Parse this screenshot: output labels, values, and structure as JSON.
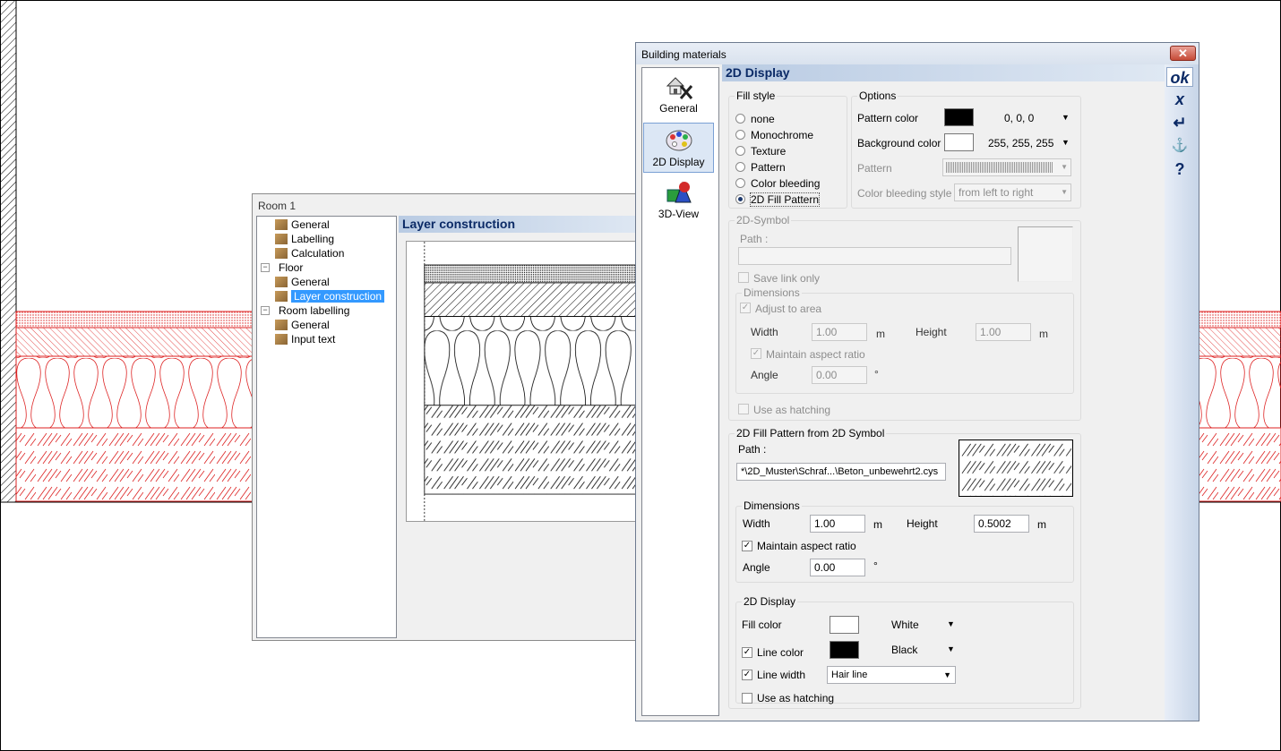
{
  "room_window": {
    "title": "Room 1",
    "section_header": "Layer construction",
    "tree": [
      {
        "label": "General",
        "indent": 1
      },
      {
        "label": "Labelling",
        "indent": 1
      },
      {
        "label": "Calculation",
        "indent": 1
      },
      {
        "label": "Floor",
        "indent": 0,
        "expand": "−"
      },
      {
        "label": "General",
        "indent": 1
      },
      {
        "label": "Layer construction",
        "indent": 1,
        "selected": true
      },
      {
        "label": "Room labelling",
        "indent": 0,
        "expand": "−"
      },
      {
        "label": "General",
        "indent": 1
      },
      {
        "label": "Input text",
        "indent": 1
      }
    ]
  },
  "dialog": {
    "title": "Building materials",
    "close_glyph": "✕",
    "section_header": "2D Display",
    "side_nav": [
      {
        "label": "General",
        "icon": "house-tools-icon"
      },
      {
        "label": "2D Display",
        "icon": "palette-icon",
        "active": true
      },
      {
        "label": "3D-View",
        "icon": "shapes-3d-icon"
      }
    ],
    "right_buttons": {
      "ok": "ok",
      "cancel": "x",
      "apply": "↵",
      "stamp": "⚓",
      "help": "?"
    },
    "fill_style": {
      "title": "Fill style",
      "options": [
        "none",
        "Monochrome",
        "Texture",
        "Pattern",
        "Color bleeding",
        "2D Fill Pattern"
      ],
      "selected": "2D Fill Pattern"
    },
    "options": {
      "title": "Options",
      "pattern_color_label": "Pattern color",
      "pattern_color_value": "0, 0, 0",
      "pattern_color_hex": "#000000",
      "background_color_label": "Background color",
      "background_color_value": "255, 255, 255",
      "background_color_hex": "#ffffff",
      "pattern_label": "Pattern",
      "color_bleeding_style_label": "Color bleeding style",
      "color_bleeding_style_value": "from left to right"
    },
    "symbol_2d": {
      "title": "2D-Symbol",
      "path_label": "Path :",
      "save_link_only": "Save link only",
      "dimensions_title": "Dimensions",
      "adjust_to_area": "Adjust to area",
      "width_label": "Width",
      "width_value": "1.00",
      "width_unit": "m",
      "height_label": "Height",
      "height_value": "1.00",
      "height_unit": "m",
      "maintain_aspect": "Maintain aspect ratio",
      "angle_label": "Angle",
      "angle_value": "0.00",
      "angle_unit": "°",
      "use_as_hatching": "Use as hatching"
    },
    "fill_pattern_2d": {
      "title": "2D Fill Pattern from 2D Symbol",
      "path_label": "Path :",
      "path_value": "*\\2D_Muster\\Schraf...\\Beton_unbewehrt2.cys",
      "dimensions_title": "Dimensions",
      "width_label": "Width",
      "width_value": "1.00",
      "width_unit": "m",
      "height_label": "Height",
      "height_value": "0.5002",
      "height_unit": "m",
      "maintain_aspect": "Maintain aspect ratio",
      "angle_label": "Angle",
      "angle_value": "0.00",
      "angle_unit": "°"
    },
    "display_2d": {
      "title": "2D Display",
      "fill_color_label": "Fill color",
      "fill_color_value": "White",
      "fill_color_hex": "#ffffff",
      "line_color_label": "Line color",
      "line_color_value": "Black",
      "line_color_hex": "#000000",
      "line_width_label": "Line width",
      "line_width_value": "Hair line",
      "use_as_hatching": "Use as hatching"
    }
  }
}
